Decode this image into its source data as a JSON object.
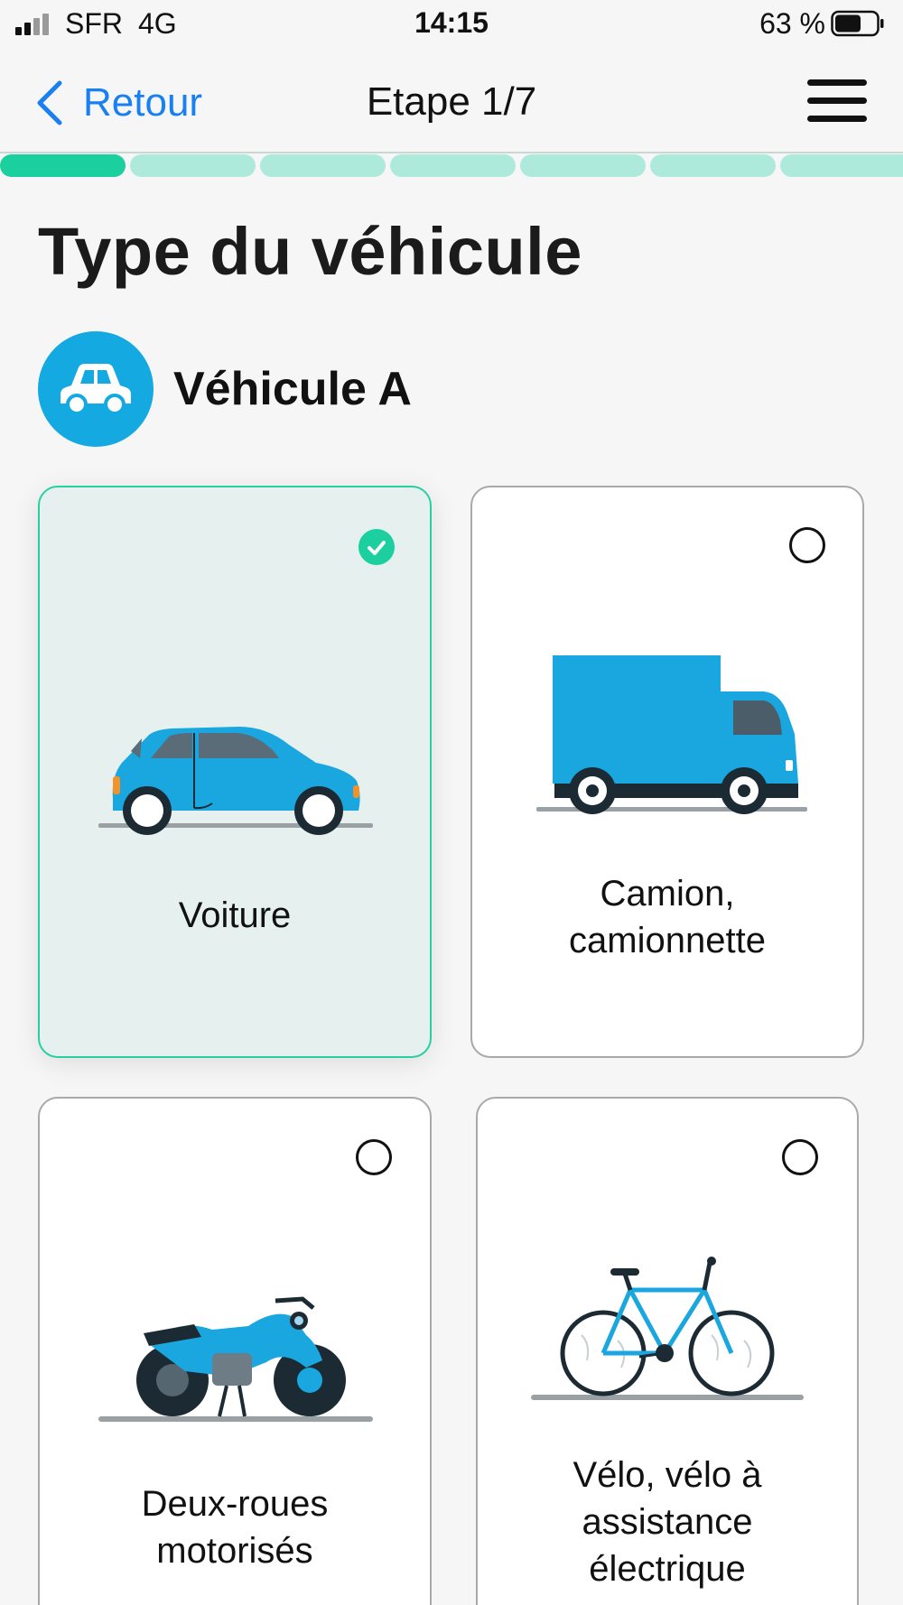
{
  "status_bar": {
    "carrier": "SFR",
    "network": "4G",
    "time": "14:15",
    "battery": "63 %",
    "signal_bars": 2,
    "battery_level": 0.63
  },
  "nav": {
    "back_label": "Retour",
    "title": "Etape 1/7",
    "back_icon": "chevron-left-icon",
    "menu_icon": "hamburger-menu-icon"
  },
  "progress": {
    "current_step": 1,
    "total_steps": 7
  },
  "page": {
    "title": "Type du véhicule"
  },
  "vehicle": {
    "name": "Véhicule A",
    "icon": "car-icon"
  },
  "options": [
    {
      "id": "voiture",
      "lines": [
        "Voiture"
      ],
      "selected": true,
      "icon": "car-illustration"
    },
    {
      "id": "camion",
      "lines": [
        "Camion,",
        "camionnette"
      ],
      "selected": false,
      "icon": "truck-illustration"
    },
    {
      "id": "deux-roues",
      "lines": [
        "Deux-roues",
        "motorisés"
      ],
      "selected": false,
      "icon": "motorcycle-illustration"
    },
    {
      "id": "velo",
      "lines": [
        "Vélo, vélo à",
        "assistance",
        "électrique"
      ],
      "selected": false,
      "icon": "bicycle-illustration"
    }
  ],
  "colors": {
    "accent": "#1ccf9e",
    "accent_light": "#aeeadc",
    "link": "#1a7ff0",
    "vehicle_blue": "#14a9e1"
  }
}
